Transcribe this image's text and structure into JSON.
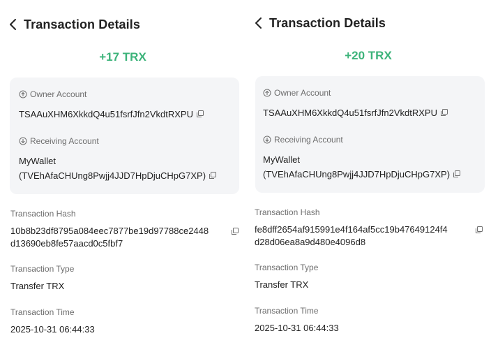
{
  "left": {
    "title": "Transaction Details",
    "amount": "+17 TRX",
    "owner_label": "Owner Account",
    "owner_value": "TSAAuXHM6XkkdQ4u51fsrfJfn2VkdtRXPU",
    "receiving_label": "Receiving Account",
    "receiving_name": "MyWallet",
    "receiving_address": "(TVEhAfaCHUng8Pwjj4JJD7HpDjuCHpG7XP)",
    "hash_label": "Transaction Hash",
    "hash_line1": "10b8b23df8795a084eec7877be19d97788ce2448",
    "hash_line2": "d13690eb8fe57aacd0c5fbf7",
    "type_label": "Transaction Type",
    "type_value": "Transfer TRX",
    "time_label": "Transaction Time",
    "time_value": "2025-10-31 06:44:33"
  },
  "right": {
    "title": "Transaction Details",
    "amount": "+20 TRX",
    "owner_label": "Owner Account",
    "owner_value": "TSAAuXHM6XkkdQ4u51fsrfJfn2VkdtRXPU",
    "receiving_label": "Receiving Account",
    "receiving_name": "MyWallet",
    "receiving_address": "(TVEhAfaCHUng8Pwjj4JJD7HpDjuCHpG7XP)",
    "hash_label": "Transaction Hash",
    "hash_line1": "fe8dff2654af915991e4f164af5cc19b47649124f4",
    "hash_line2": "d28d06ea8a9d480e4096d8",
    "type_label": "Transaction Type",
    "type_value": "Transfer TRX",
    "time_label": "Transaction Time",
    "time_value": "2025-10-31 06:44:33"
  },
  "icons": {
    "back": "chevron-left-icon",
    "outgoing": "arrow-up-circle-icon",
    "incoming": "arrow-down-circle-icon",
    "copy": "copy-icon"
  },
  "colors": {
    "amount": "#3cb37a",
    "card_background": "#f4f5f7",
    "label": "#6e6e6e"
  }
}
